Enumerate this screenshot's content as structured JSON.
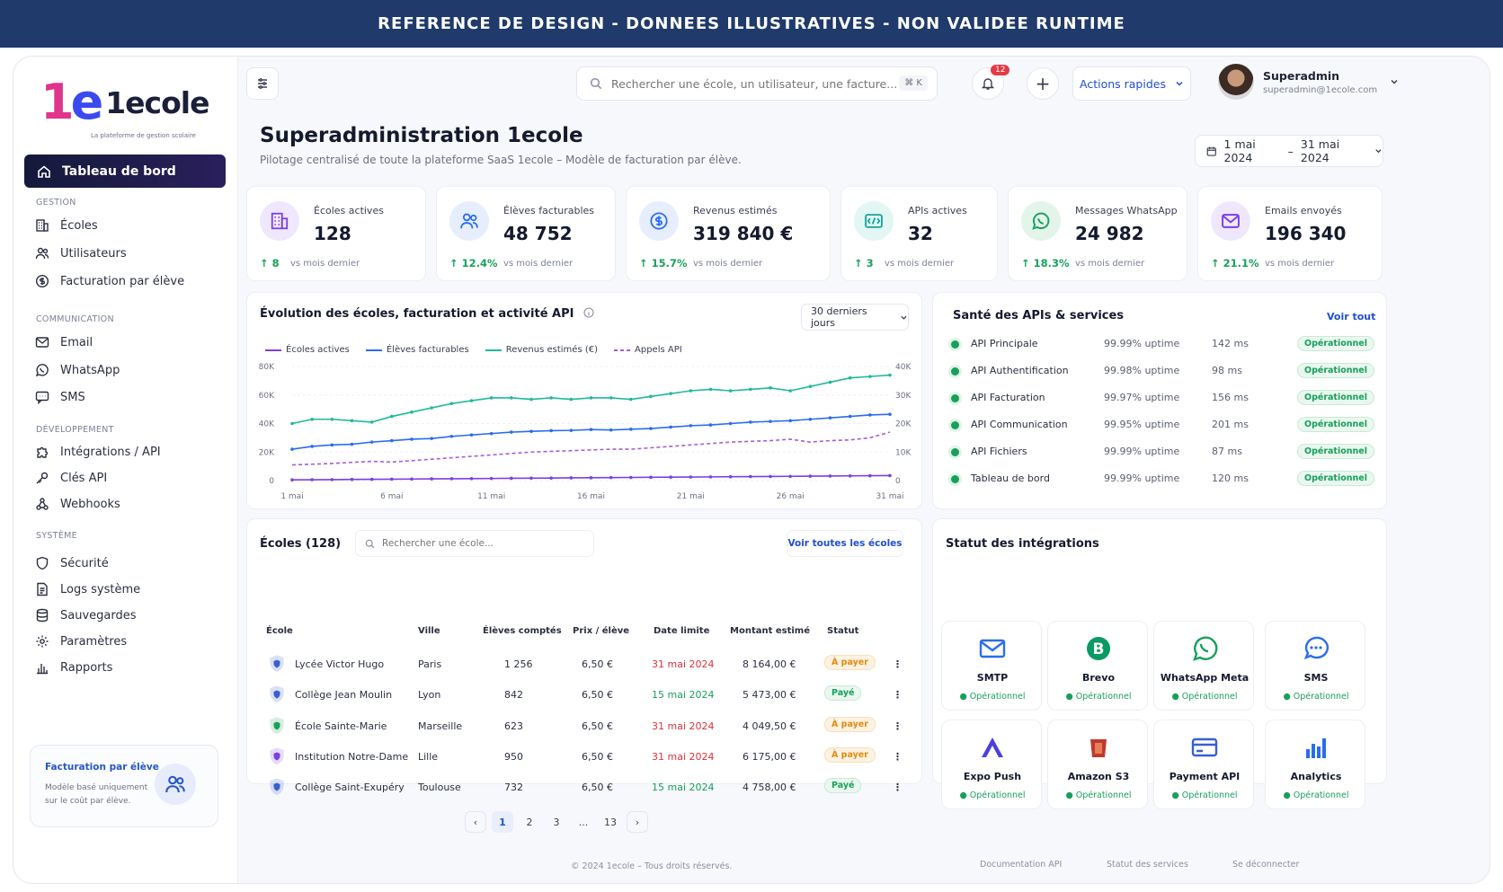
{
  "banner": "REFERENCE DE DESIGN - DONNEES ILLUSTRATIVES - NON VALIDEE RUNTIME",
  "brand": {
    "mark_a": "1",
    "mark_b": "e",
    "word": "1ecole",
    "tagline": "La plateforme de gestion scolaire"
  },
  "sidebar": {
    "active": "Tableau de bord",
    "sections": [
      {
        "title": "GESTION",
        "items": [
          "Écoles",
          "Utilisateurs",
          "Facturation par élève"
        ]
      },
      {
        "title": "COMMUNICATION",
        "items": [
          "Email",
          "WhatsApp",
          "SMS"
        ]
      },
      {
        "title": "DÉVELOPPEMENT",
        "items": [
          "Intégrations / API",
          "Clés API",
          "Webhooks"
        ]
      },
      {
        "title": "SYSTÈME",
        "items": [
          "Sécurité",
          "Logs système",
          "Sauvegardes",
          "Paramètres",
          "Rapports"
        ]
      }
    ],
    "promo": {
      "title": "Facturation par élève",
      "desc": "Modèle basé uniquement sur le coût par élève."
    }
  },
  "topbar": {
    "search_placeholder": "Rechercher une école, un utilisateur, une facture...",
    "search_shortcut": "⌘ K",
    "notifications": "12",
    "quick_actions": "Actions rapides",
    "user_name": "Superadmin",
    "user_email": "superadmin@1ecole.com"
  },
  "header": {
    "title": "Superadministration 1ecole",
    "subtitle": "Pilotage centralisé de toute la plateforme SaaS 1ecole – Modèle de facturation par élève.",
    "date_from": "1 mai 2024",
    "date_sep": "–",
    "date_to": "31 mai 2024"
  },
  "stats": [
    {
      "label": "Écoles actives",
      "value": "128",
      "delta": "8",
      "vs": "vs mois dernier",
      "color": "#7b3fe4"
    },
    {
      "label": "Élèves facturables",
      "value": "48 752",
      "delta": "12.4%",
      "vs": "vs mois dernier",
      "color": "#2a6cf0"
    },
    {
      "label": "Revenus estimés",
      "value": "319 840 €",
      "delta": "15.7%",
      "vs": "vs mois dernier",
      "color": "#2a6cf0"
    },
    {
      "label": "APIs actives",
      "value": "32",
      "delta": "3",
      "vs": "vs mois dernier",
      "color": "#14a39a"
    },
    {
      "label": "Messages WhatsApp",
      "value": "24 982",
      "delta": "18.3%",
      "vs": "vs mois dernier",
      "color": "#17a05a"
    },
    {
      "label": "Emails envoyés",
      "value": "196 340",
      "delta": "21.1%",
      "vs": "vs mois dernier",
      "color": "#7b3fe4"
    }
  ],
  "chart_panel": {
    "title": "Évolution des écoles, facturation et activité API",
    "range": "30 derniers jours"
  },
  "chart_data": {
    "type": "line",
    "x": [
      "1 mai",
      "2 mai",
      "3 mai",
      "4 mai",
      "5 mai",
      "6 mai",
      "7 mai",
      "8 mai",
      "9 mai",
      "10 mai",
      "11 mai",
      "12 mai",
      "13 mai",
      "14 mai",
      "15 mai",
      "16 mai",
      "17 mai",
      "18 mai",
      "19 mai",
      "20 mai",
      "21 mai",
      "22 mai",
      "23 mai",
      "24 mai",
      "25 mai",
      "26 mai",
      "27 mai",
      "28 mai",
      "29 mai",
      "30 mai",
      "31 mai"
    ],
    "x_ticks": [
      "1 mai",
      "6 mai",
      "11 mai",
      "16 mai",
      "21 mai",
      "26 mai",
      "31 mai"
    ],
    "y_left_ticks": [
      "80K",
      "60K",
      "40K",
      "20K",
      "0"
    ],
    "y_right_ticks": [
      "40K",
      "30K",
      "20K",
      "10K",
      "0"
    ],
    "ylim_left": [
      0,
      80000
    ],
    "ylim_right": [
      0,
      40000
    ],
    "series": [
      {
        "name": "Écoles actives",
        "color": "#7b3fe4",
        "dash": false,
        "axis": "left",
        "values": [
          500,
          600,
          700,
          800,
          900,
          1000,
          1100,
          1200,
          1300,
          1400,
          1500,
          1600,
          1700,
          1800,
          1900,
          2000,
          2100,
          2200,
          2300,
          2400,
          2500,
          2600,
          2700,
          2800,
          2900,
          3000,
          3100,
          3200,
          3300,
          3400,
          3500
        ]
      },
      {
        "name": "Élèves facturables",
        "color": "#2a6cf0",
        "dash": false,
        "axis": "left",
        "values": [
          22000,
          24000,
          25000,
          25500,
          27000,
          28000,
          29000,
          29500,
          31000,
          32000,
          33000,
          34000,
          34500,
          35000,
          35200,
          35800,
          35500,
          36000,
          36500,
          37500,
          38500,
          39000,
          40000,
          41000,
          41500,
          42000,
          43000,
          44000,
          45000,
          46000,
          46500
        ]
      },
      {
        "name": "Revenus estimés (€)",
        "color": "#1fb99a",
        "dash": false,
        "axis": "left",
        "values": [
          40000,
          43000,
          43000,
          42000,
          41000,
          45000,
          48000,
          51000,
          54000,
          56000,
          58000,
          58000,
          57000,
          58000,
          57000,
          58000,
          58000,
          57000,
          59000,
          61000,
          63000,
          64000,
          63000,
          64000,
          65000,
          63000,
          66000,
          69000,
          72000,
          73000,
          74000
        ]
      },
      {
        "name": "Appels API",
        "color": "#a45cd8",
        "dash": true,
        "axis": "left",
        "values": [
          11000,
          11500,
          12000,
          12800,
          13500,
          13000,
          14000,
          15000,
          16000,
          17000,
          18000,
          19000,
          20000,
          20500,
          21000,
          21500,
          22000,
          22000,
          23000,
          24000,
          25000,
          26000,
          27000,
          27500,
          28000,
          29000,
          27000,
          28000,
          28500,
          30000,
          34000
        ]
      }
    ]
  },
  "api_health": {
    "title": "Santé des APIs & services",
    "link": "Voir tout",
    "rows": [
      {
        "name": "API Principale",
        "uptime": "99.99% uptime",
        "ms": "142 ms",
        "status": "Opérationnel"
      },
      {
        "name": "API Authentification",
        "uptime": "99.98% uptime",
        "ms": "98 ms",
        "status": "Opérationnel"
      },
      {
        "name": "API Facturation",
        "uptime": "99.97% uptime",
        "ms": "156 ms",
        "status": "Opérationnel"
      },
      {
        "name": "API Communication",
        "uptime": "99.95% uptime",
        "ms": "201 ms",
        "status": "Opérationnel"
      },
      {
        "name": "API Fichiers",
        "uptime": "99.99% uptime",
        "ms": "87 ms",
        "status": "Opérationnel"
      },
      {
        "name": "Tableau de bord",
        "uptime": "99.99% uptime",
        "ms": "120 ms",
        "status": "Opérationnel"
      }
    ]
  },
  "schools": {
    "title": "Écoles (128)",
    "search_placeholder": "Rechercher une école...",
    "link": "Voir toutes les écoles",
    "columns": [
      "École",
      "Ville",
      "Élèves comptés",
      "Prix / élève",
      "Date limite",
      "Montant estimé",
      "Statut"
    ],
    "rows": [
      {
        "name": "Lycée Victor Hugo",
        "city": "Paris",
        "students": "1 256",
        "price": "6,50 €",
        "deadline": "31 mai 2024",
        "amount": "8 164,00 €",
        "status": "À payer",
        "paid": false,
        "shield": "#3a5fd0"
      },
      {
        "name": "Collège Jean Moulin",
        "city": "Lyon",
        "students": "842",
        "price": "6,50 €",
        "deadline": "15 mai 2024",
        "amount": "5 473,00 €",
        "status": "Payé",
        "paid": true,
        "shield": "#3a5fd0"
      },
      {
        "name": "École Sainte-Marie",
        "city": "Marseille",
        "students": "623",
        "price": "6,50 €",
        "deadline": "31 mai 2024",
        "amount": "4 049,50 €",
        "status": "À payer",
        "paid": false,
        "shield": "#17a05a"
      },
      {
        "name": "Institution Notre-Dame",
        "city": "Lille",
        "students": "950",
        "price": "6,50 €",
        "deadline": "31 mai 2024",
        "amount": "6 175,00 €",
        "status": "À payer",
        "paid": false,
        "shield": "#7b3fe4"
      },
      {
        "name": "Collège Saint-Exupéry",
        "city": "Toulouse",
        "students": "732",
        "price": "6,50 €",
        "deadline": "15 mai 2024",
        "amount": "4 758,00 €",
        "status": "Payé",
        "paid": true,
        "shield": "#3a5fd0"
      }
    ],
    "pages": [
      "1",
      "2",
      "3",
      "...",
      "13"
    ]
  },
  "integrations": {
    "title": "Statut des intégrations",
    "items": [
      {
        "name": "SMTP",
        "status": "Opérationnel",
        "icon": "mail-icon",
        "color": "#2a6cf0"
      },
      {
        "name": "Brevo",
        "status": "Opérationnel",
        "icon": "brevo-icon",
        "color": "#0b9a63"
      },
      {
        "name": "WhatsApp Meta",
        "status": "Opérationnel",
        "icon": "whatsapp-icon",
        "color": "#17a05a"
      },
      {
        "name": "SMS",
        "status": "Opérationnel",
        "icon": "chat-icon",
        "color": "#2a6cf0"
      },
      {
        "name": "Expo Push",
        "status": "Opérationnel",
        "icon": "expo-icon",
        "color": "#4b3fe0"
      },
      {
        "name": "Amazon S3",
        "status": "Opérationnel",
        "icon": "s3-icon",
        "color": "#c0392b"
      },
      {
        "name": "Payment API",
        "status": "Opérationnel",
        "icon": "card-icon",
        "color": "#3a5fd0"
      },
      {
        "name": "Analytics",
        "status": "Opérationnel",
        "icon": "analytics-icon",
        "color": "#2a6cf0"
      }
    ]
  },
  "footer": {
    "copyright": "© 2024 1ecole – Tous droits réservés.",
    "links": [
      "Documentation API",
      "Statut des services",
      "Se déconnecter"
    ]
  }
}
